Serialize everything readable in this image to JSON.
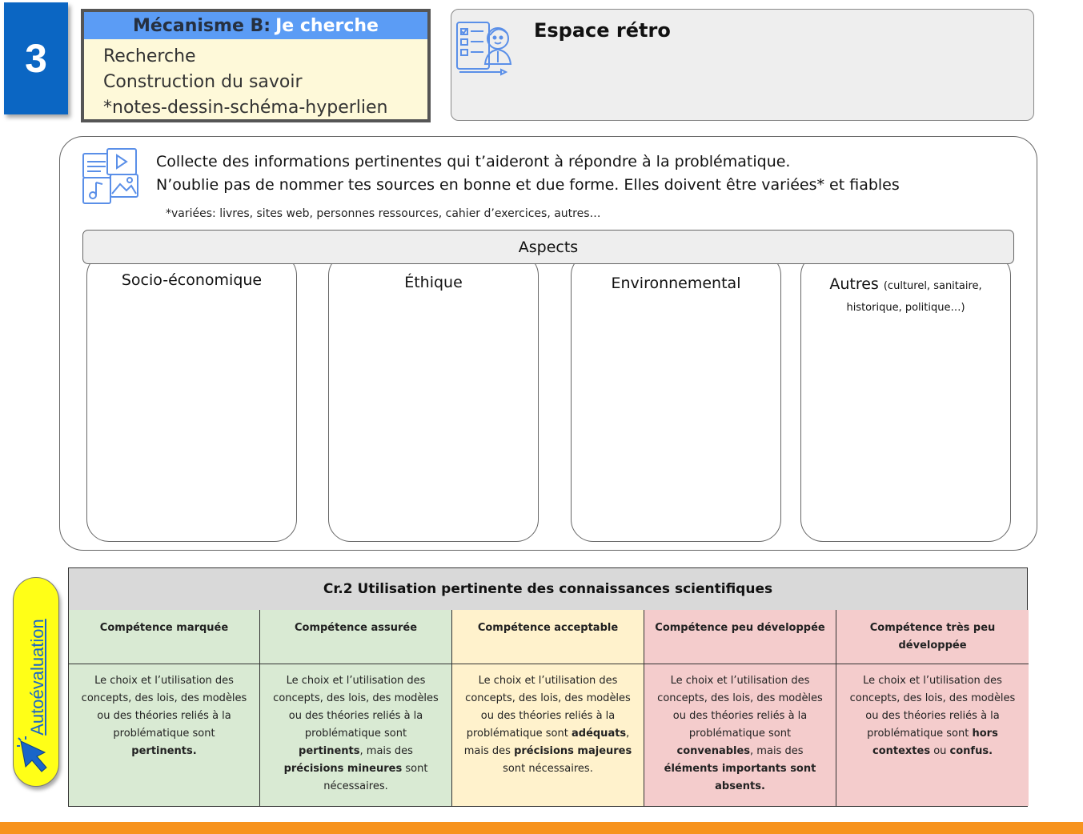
{
  "step_number": "3",
  "mechanism": {
    "title_prefix": "Mécanisme B:",
    "title_highlight": "Je cherche",
    "lines": [
      "Recherche",
      "Construction du savoir",
      "*notes-dessin-schéma-hyperlien"
    ]
  },
  "retro": {
    "title": "Espace rétro"
  },
  "instructions": {
    "line1": "Collecte des informations pertinentes qui t’aideront à répondre à la problématique.",
    "line2": "N’oublie pas de nommer tes sources en bonne et due forme. Elles doivent être variées* et fiables",
    "note": "*variées: livres, sites web, personnes ressources, cahier d’exercices, autres…"
  },
  "aspects": {
    "header": "Aspects",
    "columns": [
      {
        "title": "Socio-économique"
      },
      {
        "title": "Éthique"
      },
      {
        "title": "Environnemental"
      },
      {
        "title": "Autres",
        "subtitle_a": "(culturel, sanitaire,",
        "subtitle_b": "historique, politique…)"
      }
    ]
  },
  "rubric": {
    "title": "Cr.2 Utilisation pertinente des connaissances scientifiques",
    "levels": [
      {
        "label": "Compétence marquée",
        "color": "#d9ead3",
        "pre": "Le choix et l’utilisation des concepts, des lois, des modèles ou des théories reliés à la problématique sont ",
        "bold1": "pertinents.",
        "mid": "",
        "bold2": "",
        "post": ""
      },
      {
        "label": "Compétence assurée",
        "color": "#d9ead3",
        "pre": "Le choix et l’utilisation des concepts, des lois, des modèles ou des théories reliés à la problématique  sont ",
        "bold1": "pertinents",
        "mid": ", mais des ",
        "bold2": "précisions mineures",
        "post": " sont nécessaires."
      },
      {
        "label": "Compétence acceptable",
        "color": "#fff2cc",
        "pre": "Le choix et l’utilisation des concepts, des lois, des modèles ou des théories reliés à la problématique sont ",
        "bold1": "adéquats",
        "mid": ", mais des ",
        "bold2": "précisions majeures",
        "post": " sont nécessaires."
      },
      {
        "label": "Compétence peu développée",
        "color": "#f4cccc",
        "pre": "Le choix et l’utilisation des concepts, des lois, des modèles ou des théories reliés à la problématique sont ",
        "bold1": "convenables",
        "mid": ", mais des ",
        "bold2": "éléments importants sont absents.",
        "post": ""
      },
      {
        "label": "Compétence très peu développée",
        "color": "#f4cccc",
        "pre": "Le choix et l’utilisation des concepts, des lois, des modèles ou des théories reliés à la problématique sont ",
        "bold1": "hors contextes",
        "mid": " ou ",
        "bold2": "confus.",
        "post": ""
      }
    ]
  },
  "autoevaluation": {
    "label": "Autoévaluation"
  },
  "icons": {
    "retro": "reflection-icon",
    "research": "media-sources-icon",
    "cursor": "pointer-icon"
  },
  "colors": {
    "step_badge": "#0b66c3",
    "mechanism_header": "#5b9cf5",
    "footer_bar": "#f7931e",
    "pill": "#ffff17"
  }
}
